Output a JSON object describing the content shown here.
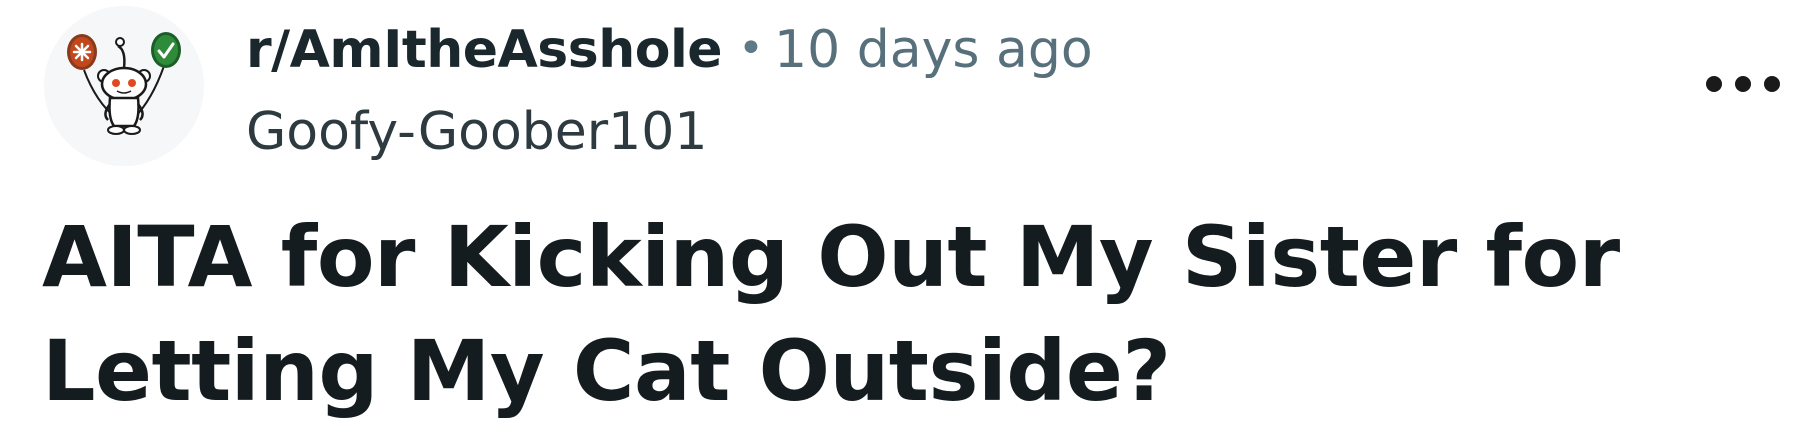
{
  "post": {
    "subreddit": "r/AmItheAsshole",
    "separator": "•",
    "time_ago": "10 days ago",
    "author": "Goofy-Goober101",
    "title": "AITA for Kicking Out My Sister for Letting My Cat Outside?"
  },
  "icons": {
    "avatar": "snoo-avatar-with-balloons-icon",
    "overflow": "more-options-icon"
  },
  "colors": {
    "subreddit_text": "#1a282d",
    "meta_text": "#58707b",
    "title_text": "#141c1f",
    "balloon_orange": "#d4501f",
    "balloon_green": "#2e8b3a"
  }
}
